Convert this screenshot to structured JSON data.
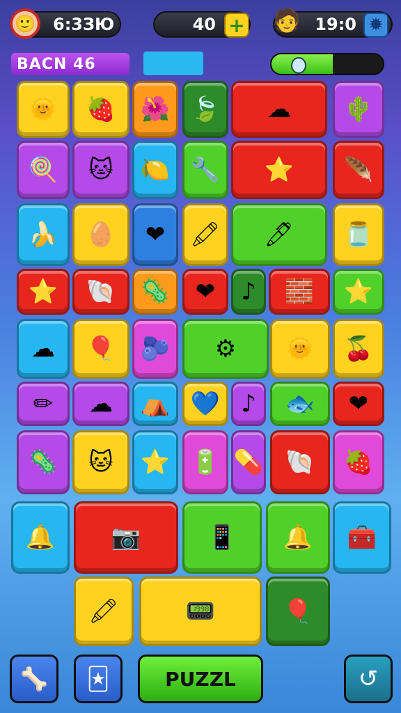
{
  "hud": {
    "score": "6:3ЗЮ",
    "coins": "40",
    "timer": "19:0",
    "level_label": "BACN  46",
    "progress": 0.55
  },
  "bottom_bar": {
    "puzzle_label": "PUZZL"
  },
  "tiles": [
    {
      "color": "yellow",
      "icon": "🌞"
    },
    {
      "color": "yellow",
      "icon": "🍓"
    },
    {
      "color": "orange",
      "icon": "🌺"
    },
    {
      "color": "dgreen",
      "icon": "🍃"
    },
    {
      "color": "red",
      "icon": "☁"
    },
    {
      "color": "purple",
      "icon": "🌵"
    },
    {
      "color": "purple",
      "icon": "🍭"
    },
    {
      "color": "purple",
      "icon": "🐱"
    },
    {
      "color": "cyan",
      "icon": "🍋"
    },
    {
      "color": "green",
      "icon": "🔧"
    },
    {
      "color": "red",
      "icon": "⭐"
    },
    {
      "color": "red",
      "icon": "🪶"
    },
    {
      "color": "cyan",
      "icon": "🍌"
    },
    {
      "color": "yellow",
      "icon": "🥚"
    },
    {
      "color": "blue",
      "icon": "❤"
    },
    {
      "color": "yellow",
      "icon": "🖍"
    },
    {
      "color": "green",
      "icon": "🖊"
    },
    {
      "color": "yellow",
      "icon": "🫙"
    },
    {
      "color": "red",
      "icon": "⭐"
    },
    {
      "color": "red",
      "icon": "🐚"
    },
    {
      "color": "orange",
      "icon": "🦠"
    },
    {
      "color": "red",
      "icon": "❤"
    },
    {
      "color": "dgreen",
      "icon": "♪"
    },
    {
      "color": "red",
      "icon": "🧱"
    },
    {
      "color": "green",
      "icon": "⭐"
    },
    {
      "color": "cyan",
      "icon": "☁"
    },
    {
      "color": "yellow",
      "icon": "🎈"
    },
    {
      "color": "pink",
      "icon": "🫐"
    },
    {
      "color": "green",
      "icon": "⚙"
    },
    {
      "color": "yellow",
      "icon": "🌞"
    },
    {
      "color": "yellow",
      "icon": "🍒"
    },
    {
      "color": "purple",
      "icon": "✏"
    },
    {
      "color": "purple",
      "icon": "☁"
    },
    {
      "color": "cyan",
      "icon": "⛺"
    },
    {
      "color": "yellow",
      "icon": "💙"
    },
    {
      "color": "purple",
      "icon": "♪"
    },
    {
      "color": "green",
      "icon": "🐟"
    },
    {
      "color": "red",
      "icon": "❤"
    },
    {
      "color": "purple",
      "icon": "🦠"
    },
    {
      "color": "yellow",
      "icon": "🐱"
    },
    {
      "color": "cyan",
      "icon": "⭐"
    },
    {
      "color": "pink",
      "icon": "🔋"
    },
    {
      "color": "purple",
      "icon": "💊"
    },
    {
      "color": "red",
      "icon": "🐚"
    },
    {
      "color": "pink",
      "icon": "🍓"
    },
    {
      "color": "cyan",
      "icon": "🔔"
    },
    {
      "color": "red",
      "icon": "📷"
    },
    {
      "color": "green",
      "icon": "📱"
    },
    {
      "color": "green",
      "icon": "🔔"
    },
    {
      "color": "cyan",
      "icon": "🧰"
    },
    {
      "color": "yellow",
      "icon": "🖍"
    },
    {
      "color": "yellow",
      "icon": "📟"
    },
    {
      "color": "dgreen",
      "icon": "🎈"
    }
  ]
}
